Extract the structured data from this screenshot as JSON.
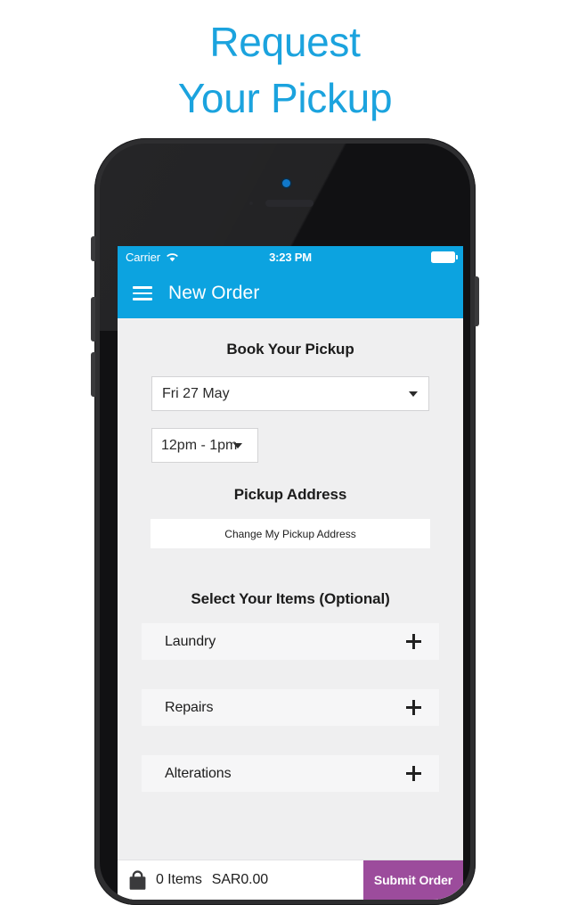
{
  "promo": {
    "headline_line1": "Request",
    "headline_line2": "Your Pickup",
    "headline_color": "#1BA3DE"
  },
  "device": {
    "frame_color": "#2e2e30",
    "icons": {
      "camera": "camera-dot-icon",
      "sensor": "proximity-sensor-icon",
      "speaker": "earpiece-speaker-icon"
    }
  },
  "status_bar": {
    "carrier": "Carrier",
    "wifi_icon": "wifi-icon",
    "time": "3:23 PM",
    "battery_icon": "battery-full-icon",
    "background": "#0CA3E0"
  },
  "nav_bar": {
    "menu_icon": "hamburger-menu-icon",
    "title": "New Order",
    "background": "#0CA3E0"
  },
  "booking": {
    "title": "Book Your Pickup",
    "date_value": "Fri 27 May",
    "date_caret_icon": "chevron-down-icon",
    "time_value": "12pm - 1pm",
    "time_caret_icon": "chevron-down-icon"
  },
  "address": {
    "title": "Pickup Address",
    "change_button_label": "Change My Pickup Address"
  },
  "items": {
    "title": "Select Your Items (Optional)",
    "add_icon": "plus-icon",
    "rows": [
      {
        "label": "Laundry"
      },
      {
        "label": "Repairs"
      },
      {
        "label": "Alterations"
      }
    ]
  },
  "cart_bar": {
    "bag_icon": "shopping-bag-icon",
    "item_count": "0 Items",
    "total": "SAR0.00",
    "submit_label": "Submit Order",
    "submit_color": "#9C4C9C"
  }
}
